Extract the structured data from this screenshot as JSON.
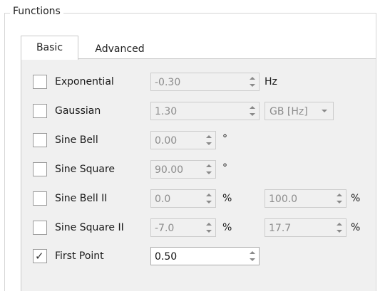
{
  "group": {
    "title": "Functions"
  },
  "tabs": [
    {
      "label": "Basic",
      "active": true
    },
    {
      "label": "Advanced",
      "active": false
    }
  ],
  "rows": [
    {
      "label": "Exponential",
      "checked": false,
      "value": "-0.30",
      "unit": "Hz"
    },
    {
      "label": "Gaussian",
      "checked": false,
      "value": "1.30",
      "select": "GB [Hz]"
    },
    {
      "label": "Sine Bell",
      "checked": false,
      "value": "0.00",
      "unit": "°"
    },
    {
      "label": "Sine Square",
      "checked": false,
      "value": "90.00",
      "unit": "°"
    },
    {
      "label": "Sine Bell II",
      "checked": false,
      "value": "0.0",
      "unit": "%",
      "value2": "100.0",
      "unit2": "%"
    },
    {
      "label": "Sine Square II",
      "checked": false,
      "value": "-7.0",
      "unit": "%",
      "value2": "17.7",
      "unit2": "%"
    },
    {
      "label": "First Point",
      "checked": true,
      "value": "0.50"
    }
  ],
  "icons": {
    "check": "checkmark-icon",
    "up": "spin-up-icon",
    "down": "spin-down-icon",
    "dropdown": "chevron-down-icon"
  }
}
